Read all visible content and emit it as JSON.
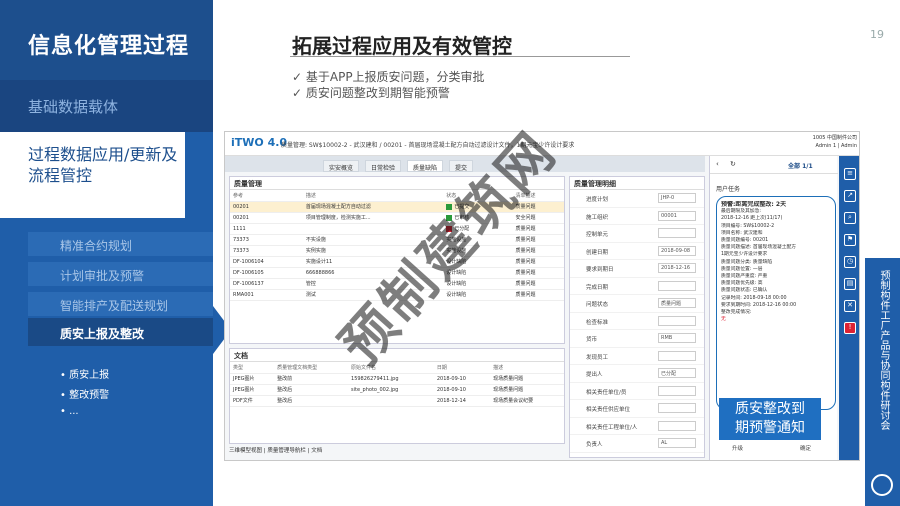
{
  "page_number": "19",
  "sidebar": {
    "title": "信息化管理过程",
    "section_basic": "基础数据载体",
    "section_active": "过程数据应用/更新及流程管控",
    "items": [
      "精准合约规划",
      "计划审批及预警",
      "智能排产及配送规划"
    ],
    "active_item": "质安上报及整改",
    "bullets": [
      "质安上报",
      "整改预警",
      "..."
    ]
  },
  "main": {
    "title": "拓展过程应用及有效管控",
    "checks": [
      "基于APP上报质安问题，分类审批",
      "质安问题整改到期智能预警"
    ]
  },
  "right_bar": {
    "vertical_text": "预制构件工厂产品与协同构件研讨会"
  },
  "app": {
    "logo": "iTWO 4.0",
    "breadcrumb": "质量管理: SW$10002-2 - 武汉建和 / 00201 - 首届现场混凝土配方自动过滤设计文件，1期元宝少许设计要求",
    "company": "1005 中国制件公司",
    "user": "Admin 1 | Admin",
    "tabs": [
      "实安概览",
      "日常检验",
      "质量缺陷",
      "提交"
    ],
    "panel1": {
      "title": "质量管理",
      "headers": [
        "参考",
        "描述",
        "状态",
        "",
        "清单描述"
      ],
      "rows": [
        [
          "00201",
          "首届现场混凝土配方自动过滤",
          "已提交",
          "",
          "质量问题"
        ],
        [
          "00201",
          "项目管理制度，检测实施工...",
          "已审核",
          "",
          "安全问题"
        ],
        [
          "1111",
          "",
          "已分配",
          "",
          "质量问题"
        ],
        [
          "73373",
          "不实设施",
          "实施设施",
          "",
          "质量问题"
        ],
        [
          "73373",
          "实例实施",
          "实施设施",
          "",
          "质量问题"
        ],
        [
          "DF-1006104",
          "实施设计11",
          "设计缺陷",
          "",
          "质量问题"
        ],
        [
          "DF-1006105",
          "666888866",
          "设计缺陷",
          "",
          "质量问题"
        ],
        [
          "DF-1006137",
          "管控",
          "设计缺陷",
          "",
          "质量问题"
        ],
        [
          "RMA001",
          "测试",
          "设计缺陷",
          "",
          "质量问题"
        ]
      ]
    },
    "panel2": {
      "title": "文档",
      "headers": [
        "类型",
        "质量管理文档类型",
        "原始文件名",
        "日期",
        "描述"
      ],
      "rows": [
        [
          "JPEG图片",
          "整改前",
          "159826279411.jpg",
          "2018-09-10",
          "现场质量问题"
        ],
        [
          "JPEG图片",
          "整改后",
          "site_photo_002.jpg",
          "2018-09-10",
          "现场质量问题"
        ],
        [
          "PDF文件",
          "整改后",
          "",
          "2018-12-14",
          "现场质量会议纪要"
        ]
      ]
    },
    "bottom_tabs": [
      "三维模型视图",
      "质量管理导航栏",
      "文档"
    ],
    "panel3": {
      "title": "质量管理明细",
      "fields": [
        [
          "进度计划",
          "JHP-0"
        ],
        [
          "施工组织",
          "00001"
        ],
        [
          "控制单元",
          ""
        ],
        [
          "创建日期",
          "2018-09-08"
        ],
        [
          "要求到期日",
          "2018-12-16"
        ],
        [
          "完成日期",
          ""
        ],
        [
          "问题状态",
          "质量问题"
        ],
        [
          "检查标准",
          ""
        ],
        [
          "货币",
          "RMB"
        ],
        [
          "发现员工",
          ""
        ],
        [
          "提出人",
          "已分配"
        ],
        [
          "相关责任单位/员",
          ""
        ],
        [
          "相关责任供应单位",
          ""
        ],
        [
          "相关责任工程单位/人",
          ""
        ],
        [
          "负责人",
          "AL"
        ]
      ]
    },
    "panel4": {
      "count": "全部 1/1",
      "section": "用户任务",
      "messages": [
        "预警:距离完成整改: 2天",
        "最后期限及其加急:",
        "2018-12-16 距上次(11/17)",
        "",
        "项目编号: SW$10002-2",
        "项目名称: 武汉建和",
        "质量问题编号: 00201",
        "质量问题描述: 首届现场混凝土配方",
        "    1期元宝少许设计要求",
        "质量问题分类: 质量缺陷",
        "质量问题位置: 一层",
        "质量问题严重度: 严重",
        "质量问题优先级: 高",
        "质量问题状态: 已确认",
        "记录时间: 2018-09-18 00:00",
        "要求到期时间: 2018-12-16 00:00",
        "整改完成情况:",
        "",
        "无"
      ],
      "callout": [
        "质安整改到",
        "期预警通知"
      ],
      "buttons": [
        "升级",
        "确定"
      ]
    }
  },
  "watermark": "预制建筑网"
}
